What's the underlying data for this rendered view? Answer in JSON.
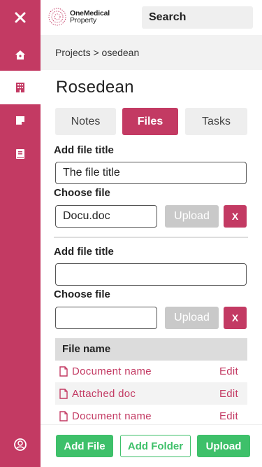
{
  "brand": {
    "line1": "OneMedical",
    "line2": "Property",
    "accent": "#c33a63"
  },
  "header": {
    "search_label": "Search"
  },
  "sidebar": {
    "items": [
      {
        "icon": "close-icon"
      },
      {
        "icon": "home-icon"
      },
      {
        "icon": "building-icon",
        "active": true
      },
      {
        "icon": "note-icon"
      },
      {
        "icon": "book-icon"
      },
      {
        "icon": "user-circle-icon"
      }
    ]
  },
  "breadcrumb": "Projects > osedean",
  "page_title": "Rosedean",
  "tabs": [
    {
      "label": "Notes"
    },
    {
      "label": "Files",
      "active": true
    },
    {
      "label": "Tasks"
    }
  ],
  "uploads": [
    {
      "title_label": "Add file title",
      "title_value": "The file title",
      "file_label": "Choose file",
      "file_value": "Docu.doc",
      "upload_label": "Upload",
      "remove_label": "X"
    },
    {
      "title_label": "Add file title",
      "title_value": "",
      "file_label": "Choose file",
      "file_value": "",
      "upload_label": "Upload",
      "remove_label": "X"
    }
  ],
  "files_table": {
    "header": "File name",
    "rows": [
      {
        "name": "Document name",
        "action": "Edit"
      },
      {
        "name": "Attached doc",
        "action": "Edit"
      },
      {
        "name": "Document name",
        "action": "Edit"
      }
    ]
  },
  "footer": {
    "add_file": "Add File",
    "add_folder": "Add Folder",
    "upload": "Upload",
    "button_color": "#3ec06a"
  }
}
